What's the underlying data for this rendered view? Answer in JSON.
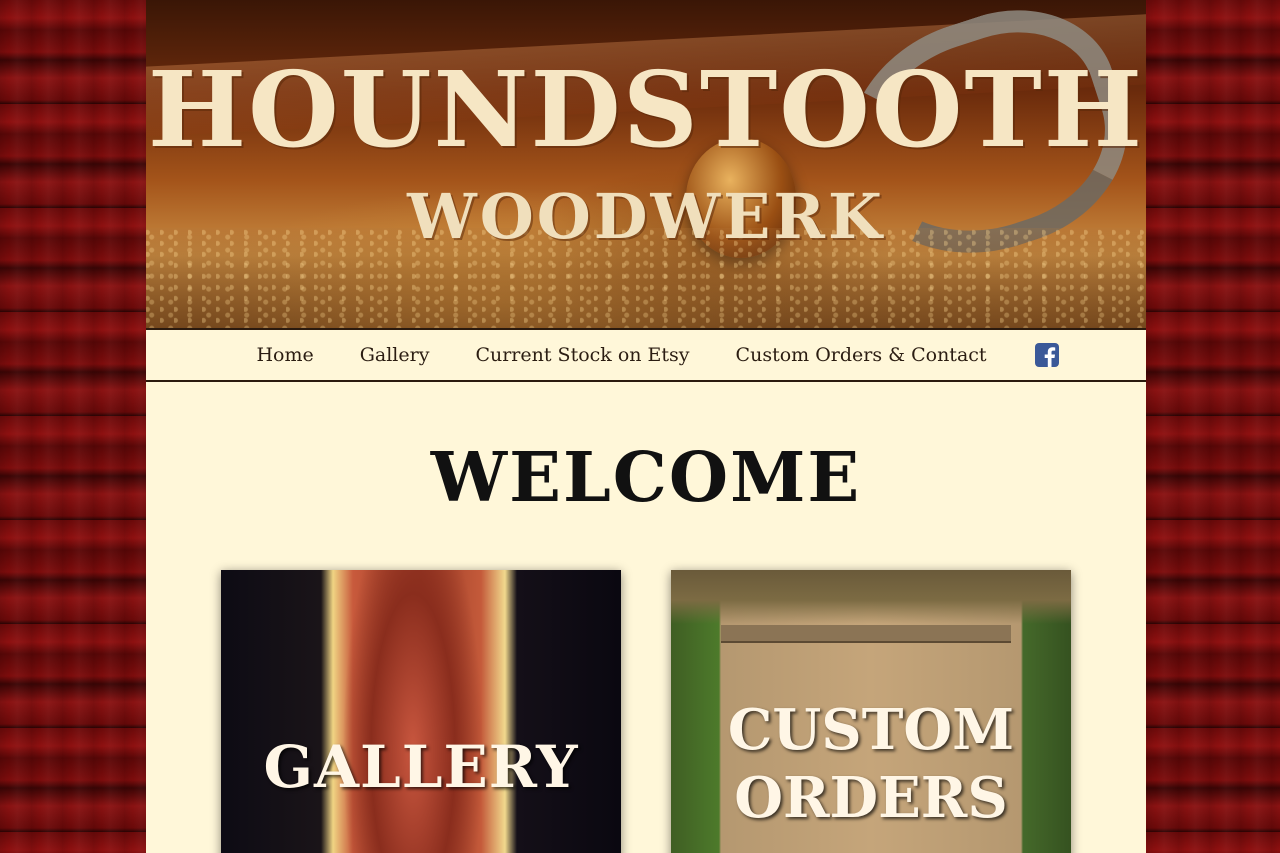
{
  "brand": {
    "title": "HOUNDSTOOTH",
    "subtitle": "WOODWERK"
  },
  "nav": {
    "items": [
      {
        "label": "Home"
      },
      {
        "label": "Gallery"
      },
      {
        "label": "Current Stock on Etsy"
      },
      {
        "label": "Custom Orders & Contact"
      }
    ],
    "social_icon": "facebook-icon"
  },
  "main": {
    "heading": "WELCOME",
    "tiles": [
      {
        "label": "GALLERY"
      },
      {
        "label_line1": "CUSTOM",
        "label_line2": "ORDERS"
      }
    ]
  },
  "colors": {
    "page_background": "#fff7d9",
    "body_wood": "#6b0a0a",
    "facebook": "#3b5998",
    "nav_text": "#2b1d12"
  }
}
